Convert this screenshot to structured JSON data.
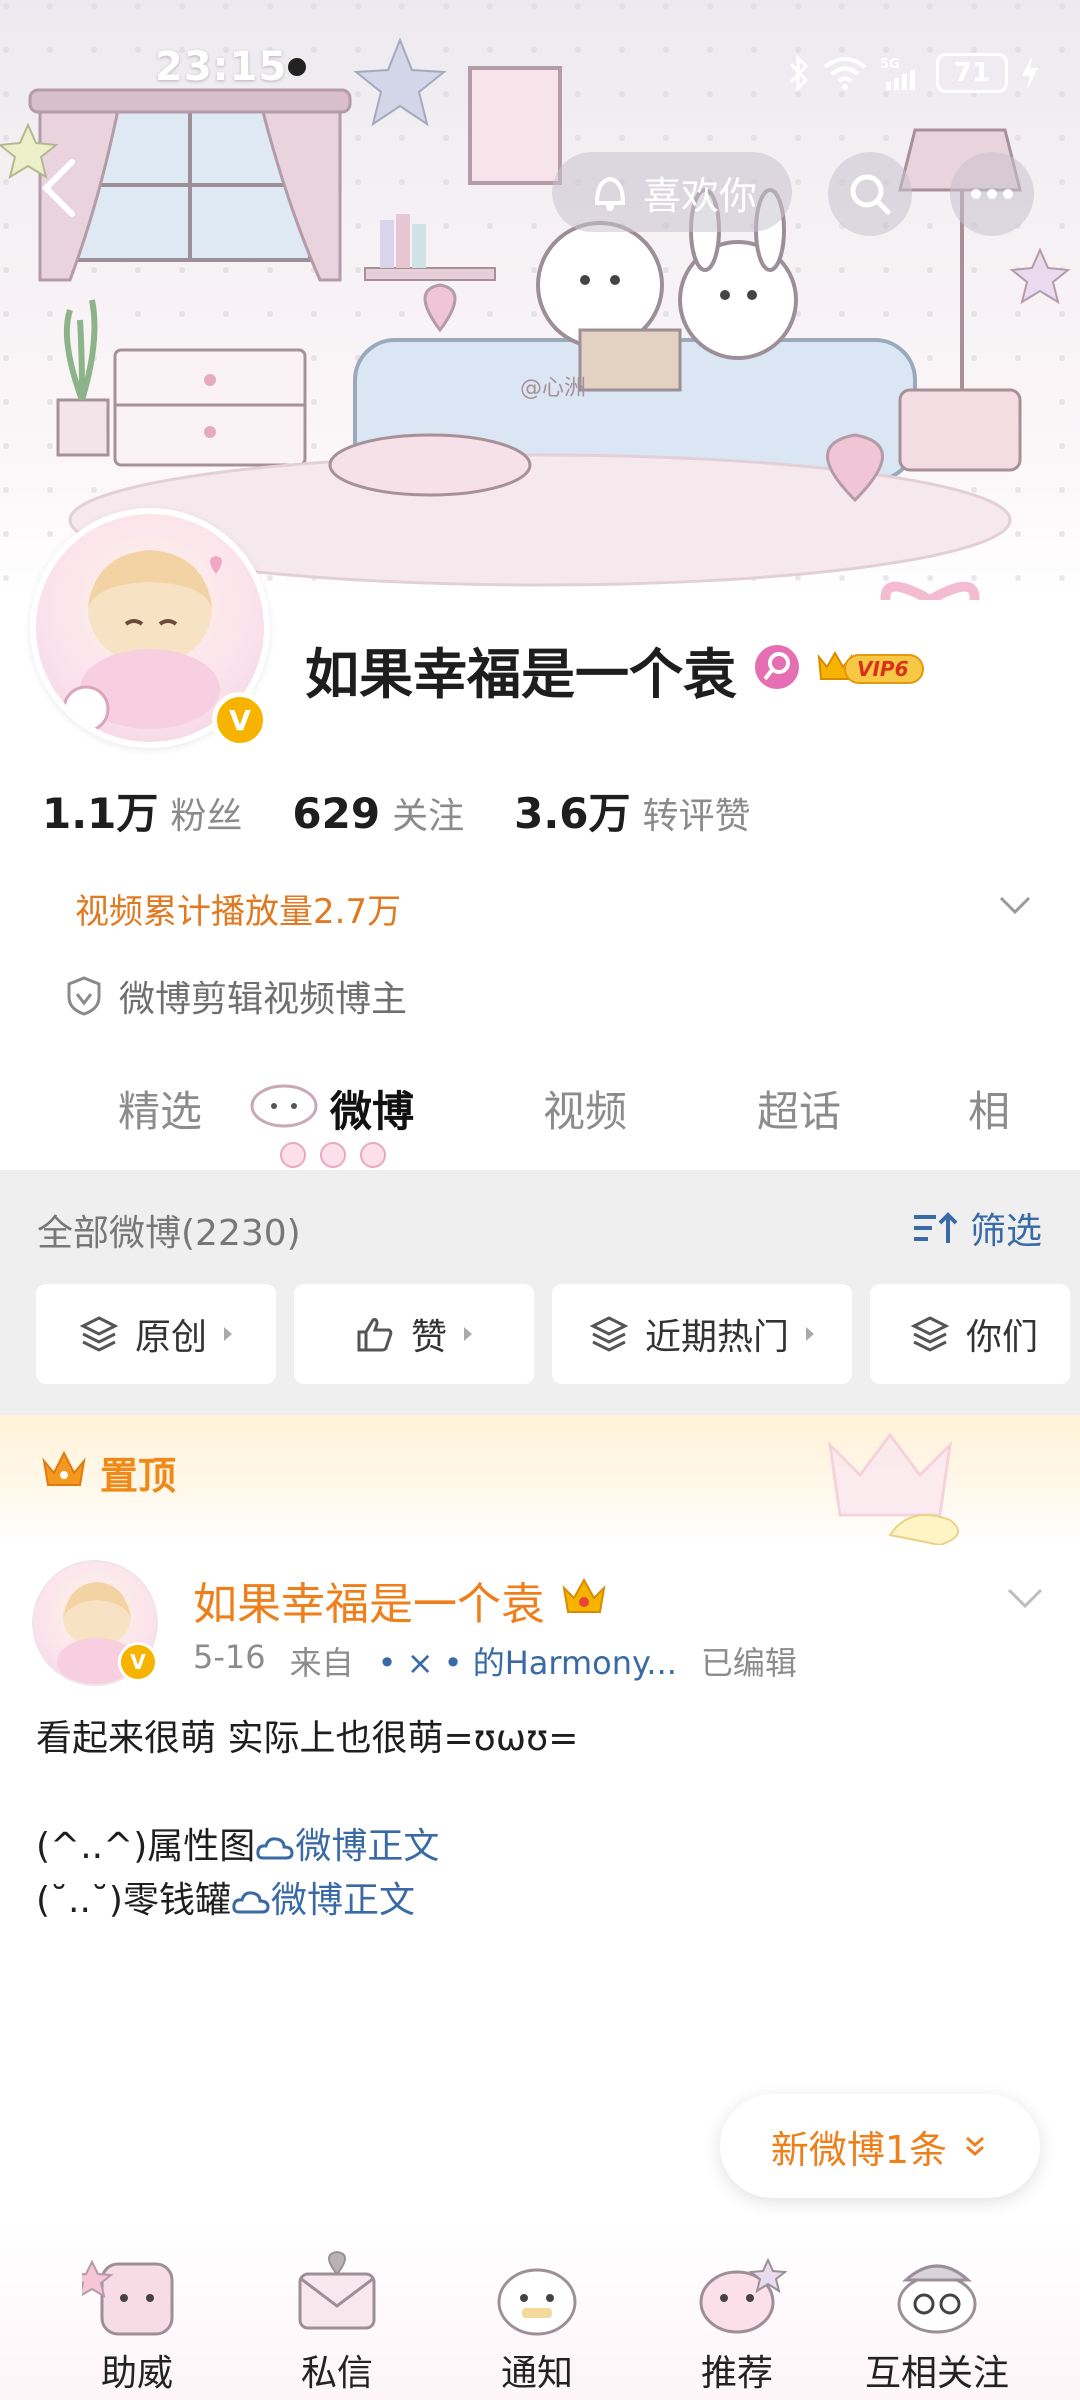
{
  "status_bar": {
    "time": "23:15",
    "battery": "71"
  },
  "top_nav": {
    "like_label": "喜欢你"
  },
  "profile": {
    "name": "如果幸福是一个袁",
    "vip_level": "VIP6",
    "verify_mark": "V",
    "banner_watermark": "@心洲"
  },
  "stats": [
    {
      "value": "1.1万",
      "label": "粉丝"
    },
    {
      "value": "629",
      "label": "关注"
    },
    {
      "value": "3.6万",
      "label": "转评赞"
    }
  ],
  "video_stat": "视频累计播放量2.7万",
  "creator_tag": "微博剪辑视频博主",
  "tabs": [
    {
      "label": "精选",
      "active": false
    },
    {
      "label": "微博",
      "active": true
    },
    {
      "label": "视频",
      "active": false
    },
    {
      "label": "超话",
      "active": false
    },
    {
      "label": "相",
      "active": false
    }
  ],
  "filter": {
    "all_weibo": "全部微博(2230)",
    "filter_label": "筛选",
    "chips": [
      "原创",
      "赞",
      "近期热门",
      "你们"
    ]
  },
  "pinned": {
    "label": "置顶"
  },
  "post": {
    "author": "如果幸福是一个袁",
    "date": "5-16",
    "from_label": "来自",
    "source": "• × • 的Harmony...",
    "edited": "已编辑",
    "text_line1": "看起来很萌 实际上也很萌=ʊωʊ=",
    "line2_prefix": "(^..^)属性图",
    "line2_link": "微博正文",
    "line3_prefix": "(˘..˘)零钱罐",
    "line3_link": "微博正文"
  },
  "new_weibo": "新微博1条",
  "bottom_nav": [
    "助威",
    "私信",
    "通知",
    "推荐",
    "互相关注"
  ],
  "colors": {
    "accent_orange": "#ef7f1a",
    "link_blue": "#3a6aa6",
    "verify_gold": "#f6b400"
  },
  "icons": [
    "back-arrow-icon",
    "bell-heart-icon",
    "search-icon",
    "more-icon",
    "shield-icon",
    "chevron-down-icon",
    "filter-sort-icon",
    "layers-icon",
    "thumb-up-icon",
    "crown-icon",
    "cloud-link-icon"
  ]
}
